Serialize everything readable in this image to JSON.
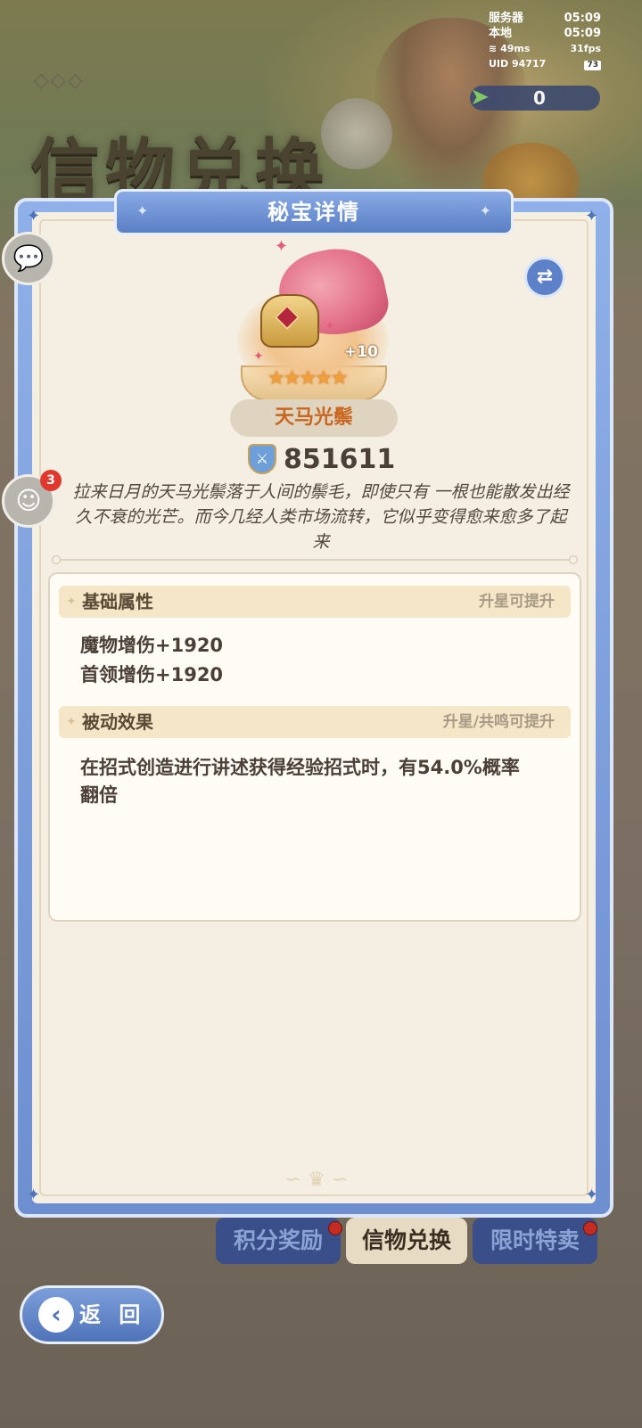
{
  "background": {
    "page_title": "信物兑换",
    "deco": "◇◇◇"
  },
  "status": {
    "server_label": "服务器",
    "server_time": "05:09",
    "local_label": "本地",
    "local_time": "05:09",
    "ping": "49ms",
    "fps": "31fps",
    "uid": "UID  94717",
    "battery": "73"
  },
  "currency": {
    "icon": "paper-plane-icon",
    "value": "0"
  },
  "panel": {
    "title": "秘宝详情",
    "item": {
      "level": "+10",
      "stars": "★★★★★",
      "name": "天马光鬃",
      "power": "851611",
      "description": "拉来日月的天马光鬃落于人间的鬃毛，即使只有 一根也能散发出经久不衰的光芒。而今几经人类市场流转，它似乎变得愈来愈多了起来"
    },
    "basic": {
      "title": "基础属性",
      "hint": "升星可提升",
      "lines": [
        "魔物增伤+1920",
        "首领增伤+1920"
      ]
    },
    "passive": {
      "title": "被动效果",
      "hint": "升星/共鸣可提升",
      "lines": [
        "在招式创造进行讲述获得经验招式时，有54.0%概率",
        "翻倍"
      ]
    }
  },
  "side": {
    "chat_icon": "chat-bubble-icon",
    "bot_icon": "robot-icon",
    "bot_badge": "3"
  },
  "tabs": [
    "积分奖励",
    "信物兑换",
    "限时特卖"
  ],
  "back": {
    "label": "返 回",
    "icon": "back-arrow-icon"
  },
  "colors": {
    "panel_blue": "#6d8fd0",
    "item_name": "#c9661f",
    "paper": "#f4efe2"
  }
}
